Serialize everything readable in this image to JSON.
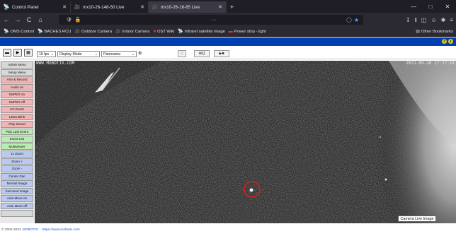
{
  "browser": {
    "tabs": [
      {
        "icon": "sat-icon",
        "label": "Control Panel",
        "active": false
      },
      {
        "icon": "cam-icon",
        "label": "mx10-26-148-50 Live",
        "active": false
      },
      {
        "icon": "cam-icon",
        "label": "mx10-26-16-85 Live",
        "active": true
      }
    ],
    "new_tab": "+",
    "window_controls": [
      "—",
      "□",
      "✕"
    ],
    "nav": {
      "back": "←",
      "forward": "→",
      "reload": "C",
      "home": "⌂"
    },
    "url": "",
    "url_dots": "···",
    "bookmarks": [
      {
        "icon": "sat-icon",
        "label": "OMS Control"
      },
      {
        "icon": "sat-icon",
        "label": "BACHES RCU"
      },
      {
        "icon": "cam-icon",
        "label": "Outdoor Camera"
      },
      {
        "icon": "cam-icon",
        "label": "Indoor Camera"
      },
      {
        "icon": "book-icon",
        "label": "OST Wiki"
      },
      {
        "icon": "sat-icon",
        "label": "Infraret satellite image"
      },
      {
        "icon": "plug-icon",
        "label": "Power strip - light"
      }
    ],
    "other_bookmarks": "Other Bookmarks"
  },
  "toolbar": {
    "fps": "16 fps",
    "display_mode": "Display Mode",
    "panorama": "Panorama",
    "hq_label": "HiQ",
    "rec_label": "▶■"
  },
  "sidebar": {
    "items": [
      {
        "label": "Admin Menu",
        "style": "gray"
      },
      {
        "label": "Setup Menu",
        "style": "gray"
      },
      {
        "label": "Arm & Record",
        "style": "red"
      },
      {
        "label": "Audio on",
        "style": "red"
      },
      {
        "label": "MxPEG on",
        "style": "red"
      },
      {
        "label": "MxPEG off",
        "style": "red"
      },
      {
        "label": "UC Event",
        "style": "red"
      },
      {
        "label": "LEDs Blink",
        "style": "red"
      },
      {
        "label": "Play Sound",
        "style": "red"
      },
      {
        "label": "Play Last Event",
        "style": "green"
      },
      {
        "label": "Event List",
        "style": "green"
      },
      {
        "label": "Multiviewer",
        "style": "green"
      },
      {
        "label": "1x Zoom",
        "style": "blue"
      },
      {
        "label": "Zoom +",
        "style": "blue"
      },
      {
        "label": "Zoom -",
        "style": "blue"
      },
      {
        "label": "Center Pan",
        "style": "blue"
      },
      {
        "label": "Normal Image",
        "style": "blue"
      },
      {
        "label": "Surround Image",
        "style": "blue"
      },
      {
        "label": "Auto Move on",
        "style": "blue"
      },
      {
        "label": "Auto Move off",
        "style": "blue"
      },
      {
        "label": "",
        "style": "gray"
      }
    ]
  },
  "camera": {
    "overlay_left": "WWW.MOBOTIX.COM",
    "overlay_right": "2021-09-26 17:27:18",
    "tooltip": "Camera Live Image"
  },
  "footer": {
    "copyright": "© 2001-2021",
    "brand": "MOBOTIX",
    "sep": "-",
    "url": "https://www.mobotix.com"
  },
  "colors": {
    "accent_blue": "#003fb3",
    "tab_bg": "#1f1e25",
    "nav_bg": "#2b2a33"
  }
}
